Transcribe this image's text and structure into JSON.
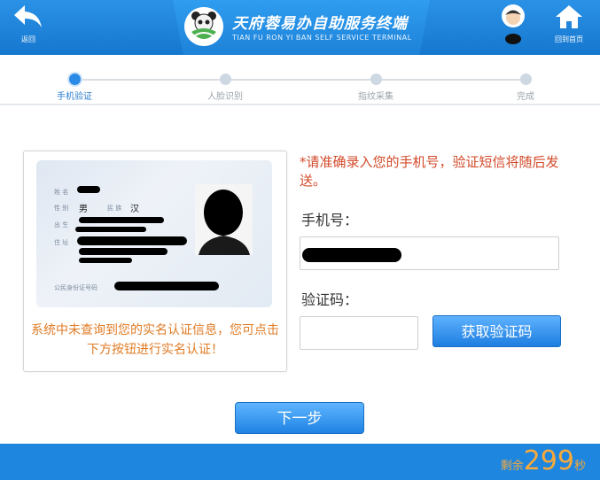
{
  "header": {
    "back_label": "返回",
    "title": "天府蓉易办自助服务终端",
    "subtitle": "TIAN FU RON YI BAN SELF SERVICE TERMINAL",
    "home_label": "回到首页"
  },
  "steps": [
    {
      "label": "手机验证",
      "active": true
    },
    {
      "label": "人脸识别",
      "active": false
    },
    {
      "label": "指纹采集",
      "active": false
    },
    {
      "label": "完成",
      "active": false
    }
  ],
  "idcard": {
    "name_label": "姓 名",
    "gender_label": "性 别",
    "gender_value": "男",
    "ethnicity_label": "民 族",
    "ethnicity_value": "汉",
    "birth_label": "出 生",
    "address_label": "住 址",
    "id_label": "公民身份证号码"
  },
  "warning": "系统中未查询到您的实名认证信息，您可点击下方按钮进行实名认证！",
  "form": {
    "notice": "*请准确录入您的手机号，验证短信将随后发送。",
    "phone_label": "手机号：",
    "code_label": "验证码：",
    "get_code_button": "获取验证码",
    "next_button": "下一步"
  },
  "footer": {
    "timer_prefix": "剩余",
    "timer_value": "299",
    "timer_suffix": "秒"
  },
  "colors": {
    "header_blue": "#1f86e0",
    "notice_red": "#d24a2a",
    "warning_orange": "#e07b24",
    "timer_orange": "#f7a93a"
  }
}
